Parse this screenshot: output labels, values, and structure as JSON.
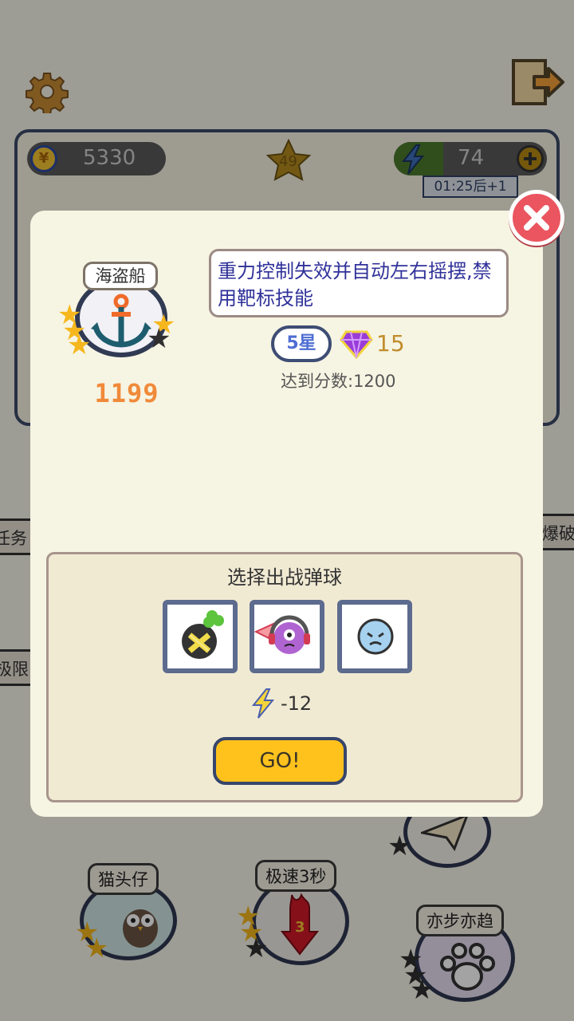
{
  "background": {
    "coins": "5330",
    "level_star": "49",
    "energy": "74",
    "energy_timer": "01:25后+1",
    "side_labels": {
      "task": "任务",
      "limit": "极限",
      "blast": "爆破"
    },
    "levels": [
      {
        "label": "猫头仔"
      },
      {
        "label": "极速3秒",
        "badge": "3"
      },
      {
        "label": "亦步亦趋"
      }
    ]
  },
  "dialog": {
    "level_name": "海盗船",
    "level_score": "1199",
    "description": "重力控制失效并自动左右摇摆,禁用靶标技能",
    "star_level": "5星",
    "gem_reward": "15",
    "target": "达到分数:1200",
    "choose_title": "选择出战弹球",
    "energy_cost": "-12",
    "go_label": "GO!"
  },
  "colors": {
    "accent": "#ffc21d",
    "frame": "#3c4a68",
    "score": "#f08a3a",
    "close": "#ea5560",
    "desc_text": "#30329a"
  },
  "icons": [
    "gear-icon",
    "exit-icon",
    "coin-icon",
    "star-icon",
    "lightning-icon",
    "plus-icon",
    "close-icon",
    "anchor-icon",
    "gem-icon",
    "bomb-ball-icon",
    "headphone-ball-icon",
    "sleepy-ball-icon"
  ]
}
